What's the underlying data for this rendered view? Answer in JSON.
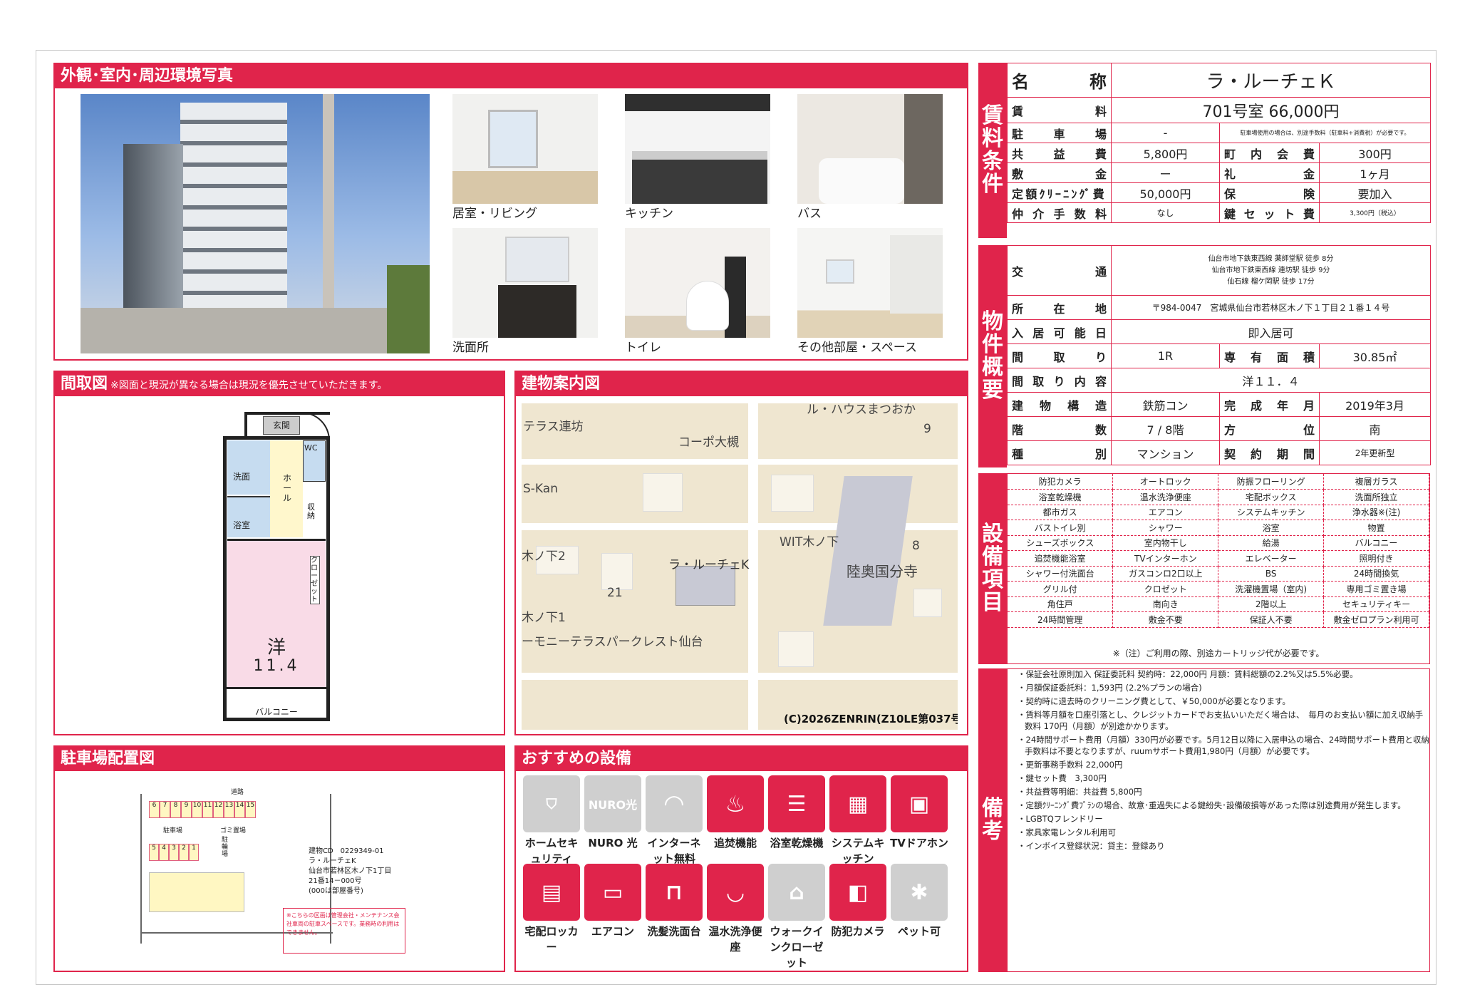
{
  "photos": {
    "title": "外観･室内･周辺環境写真",
    "captions": [
      "居室・リビング",
      "キッチン",
      "バス",
      "洗面所",
      "トイレ",
      "その他部屋・スペース"
    ]
  },
  "floorplan": {
    "title": "間取図",
    "note": "※図面と現況が異なる場合は現況を優先させていただきます。",
    "rooms": {
      "entrance": "玄関",
      "wash": "洗面",
      "wc": "WC",
      "hall": "ホール",
      "bath": "浴室",
      "storage": "収納",
      "closet": "クローゼット",
      "main": "洋",
      "size": "11.4",
      "balcony": "バルコニー"
    }
  },
  "map": {
    "title": "建物案内図",
    "labels": [
      "テラス連坊",
      "コーポ大槻",
      "S-Kan",
      "ル・ハウスまつおか",
      "WIT木ノ下",
      "陸奥国分寺",
      "木ノ下2",
      "ラ・ルーチェK",
      "21",
      "木ノ下1",
      "ーモニーテラスパークレスト仙台",
      "9",
      "8"
    ],
    "copyright": "(C)2026ZENRIN(Z10LE第037号)"
  },
  "parking": {
    "title": "駐車場配置図",
    "road": "道路",
    "lot": "駐車場",
    "nums_top": [
      "6",
      "7",
      "8",
      "9",
      "10",
      "11",
      "12",
      "13",
      "14",
      "15"
    ],
    "nums_bot": [
      "5",
      "4",
      "3",
      "2",
      "1"
    ],
    "garbage": "ゴミ置場",
    "bike": "駐輪場",
    "code": "建物CD　0229349-01",
    "name": "ラ・ルーチェK",
    "addr1": "仙台市若林区木ノ下1丁目",
    "addr2": "21番14－000号",
    "addr3": "(000は部屋番号)",
    "warn": "※こちらの区画は管理会社・メンテナンス会社車両の駐車スペースです。業務時の利用はできません。"
  },
  "amenity": {
    "title": "おすすめの設備",
    "items": [
      "ホームセキュリティ",
      "NURO 光",
      "インターネット無料",
      "追焚機能",
      "浴室乾燥機",
      "システムキッチン",
      "TVドアホン",
      "宅配ロッカー",
      "エアコン",
      "洗髪洗面台",
      "温水洗浄便座",
      "ウォークインクローゼット",
      "防犯カメラ",
      "ペット可"
    ],
    "nuro_icon": "NURO光"
  },
  "rent": {
    "side": "賃料条件",
    "name_k": "名　　称",
    "name": "ラ・ルーチェＫ",
    "rent_k": "賃　　料",
    "rent": "701号室 66,000円",
    "park_k": "駐車場",
    "park": "-",
    "park_note": "駐車場使用の場合は、別途手数料（駐車料+消費税）が必要です。",
    "common_k": "共益費",
    "common": "5,800円",
    "town_k": "町内会費",
    "town": "300円",
    "deposit_k": "敷金",
    "deposit": "ー",
    "key_money_k": "礼金",
    "key_money": "1ヶ月",
    "clean_k": "定額ｸﾘｰﾆﾝｸﾞ費",
    "clean": "50,000円",
    "ins_k": "保険",
    "ins": "要加入",
    "agent_k": "仲介手数料",
    "agent": "なし",
    "keyset_k": "鍵セット費",
    "keyset": "3,300円（税込）"
  },
  "prop": {
    "side": "物件概要",
    "traffic_k": "交通",
    "traffic": [
      "仙台市地下鉄東西線 薬師堂駅 徒歩 8分",
      "仙台市地下鉄東西線 連坊駅 徒歩 9分",
      "仙石線 榴ケ岡駅 徒歩 17分"
    ],
    "addr_k": "所在地",
    "addr": "〒984-0047　宮城県仙台市若林区木ノ下１丁目２１番１４号",
    "move_k": "入居可能日",
    "move": "即入居可",
    "layout_k": "間取り",
    "layout": "1R",
    "area_k": "専有面積",
    "area": "30.85㎡",
    "detail_k": "間取り内容",
    "detail": "洋１１．４",
    "struct_k": "建物構造",
    "struct": "鉄筋コン",
    "built_k": "完成年月",
    "built": "2019年3月",
    "floor_k": "階数",
    "floor": "7 / 8階",
    "dir_k": "方位",
    "dir": "南",
    "type_k": "種別",
    "type": "マンション",
    "term_k": "契約期間",
    "term": "2年更新型"
  },
  "equip": {
    "side": "設備項目",
    "rows": [
      [
        "防犯カメラ",
        "オートロック",
        "防振フローリング",
        "複層ガラス"
      ],
      [
        "浴室乾燥機",
        "温水洗浄便座",
        "宅配ボックス",
        "洗面所独立"
      ],
      [
        "都市ガス",
        "エアコン",
        "システムキッチン",
        "浄水器※(注)"
      ],
      [
        "バストイレ別",
        "シャワー",
        "浴室",
        "物置"
      ],
      [
        "シューズボックス",
        "室内物干し",
        "給湯",
        "バルコニー"
      ],
      [
        "追焚機能浴室",
        "TVインターホン",
        "エレベーター",
        "照明付き"
      ],
      [
        "シャワー付洗面台",
        "ガスコンロ2口以上",
        "BS",
        "24時間換気"
      ],
      [
        "グリル付",
        "クロゼット",
        "洗濯機置場（室内)",
        "専用ゴミ置き場"
      ],
      [
        "角住戸",
        "南向き",
        "2階以上",
        "セキュリティキー"
      ],
      [
        "24時間管理",
        "敷金不要",
        "保証人不要",
        "敷金ゼロプラン利用可"
      ]
    ],
    "note": "※（注）ご利用の際、別途カートリッジ代が必要です。"
  },
  "remarks": {
    "side": "備考",
    "items": [
      "保証会社原則加入 保証委託料 契約時：22,000円 月額：賃料総額の2.2%又は5.5%必要。",
      "月額保証委託料：1,593円 (2.2%プランの場合)",
      "契約時に退去時のクリーニング費として、￥50,000が必要となります。",
      "賃料等月額を口座引落とし、クレジットカードでお支払いいただく場合は、　毎月のお支払い額に加え収納手数料 170円（月額）が別途かかります。",
      "24時間サポート費用（月額）330円が必要です。5月12日以降に入居申込の場合、24時間サポート費用と収納手数料は不要となりますが、ruumサポート費用1,980円（月額）が必要です。",
      "更新事務手数料 22,000円",
      "鍵セット費　3,300円",
      "共益費等明細：共益費 5,800円",
      "定額ｸﾘｰﾆﾝｸﾞ費ﾌﾟﾗﾝの場合、故意･重過失による鍵紛失･設備破損等があった際は別途費用が発生します。",
      "LGBTQフレンドリー",
      "家具家電レンタル利用可",
      "インボイス登録状況：貸主：登録あり"
    ]
  }
}
